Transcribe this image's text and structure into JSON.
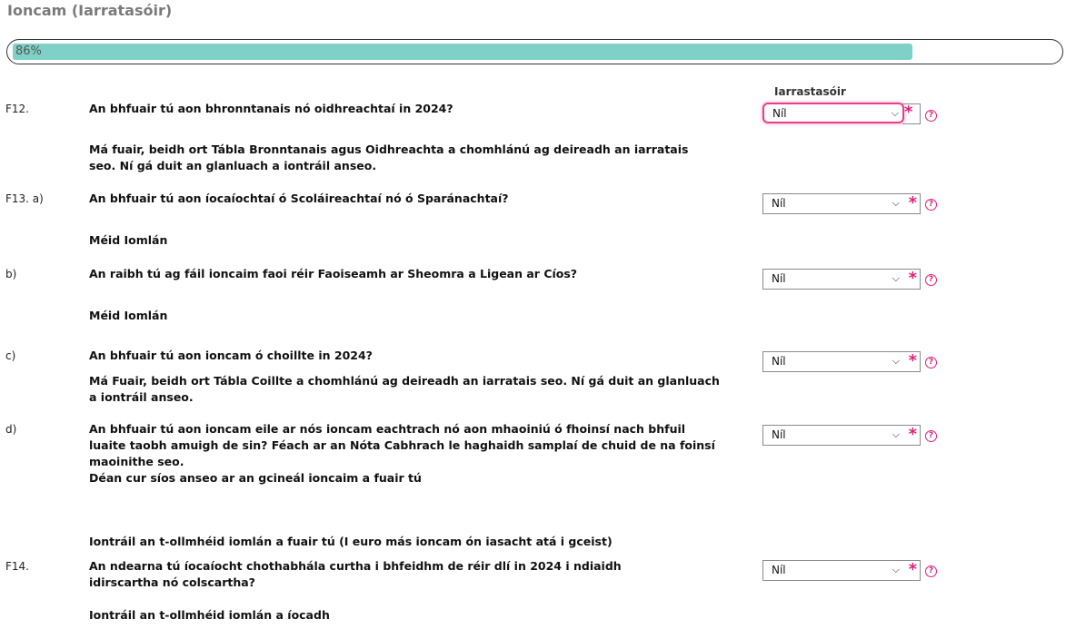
{
  "page": {
    "title": "Ioncam (Iarratasóir)"
  },
  "progress": {
    "percent": 86,
    "label": "86%"
  },
  "column_header": "Iarrastasóir",
  "questions": [
    {
      "num": "F12.",
      "text": "An bhfuair tú aon bhronntanais nó oidhreachtaí in 2024?",
      "value": "Níl"
    },
    {
      "text": "Má fuair, beidh ort Tábla Bronntanais agus Oidhreachta a chomhlánú ag deireadh an iarratais seo. Ní gá duit an glanluach a iontráil anseo."
    },
    {
      "num": "F13. a)",
      "text": "An bhfuair tú aon íocaíochtaí ó Scoláireachtaí nó ó Sparánachtaí?",
      "value": "Níl"
    },
    {
      "text": "Méid Iomlán"
    },
    {
      "num": "b)",
      "text": "An raibh tú ag fáil ioncaim faoi réir Faoiseamh ar Sheomra a Ligean ar Cíos?",
      "value": "Níl"
    },
    {
      "text": "Méid Iomlán"
    },
    {
      "num": "c)",
      "text": "An bhfuair tú aon ioncam ó choillte in 2024?",
      "value": "Níl"
    },
    {
      "text": "Má Fuair, beidh ort Tábla Coillte a chomhlánú ag deireadh an iarratais seo. Ní gá duit an glanluach a iontráil anseo."
    },
    {
      "num": "d)",
      "text": "An bhfuair tú aon ioncam eile ar nós ioncam eachtrach nó aon mhaoiniú ó fhoinsí nach bhfuil luaite taobh amuigh de sin? Féach ar an Nóta Cabhrach le haghaidh samplaí de chuid de na foinsí maoinithe seo.",
      "value": "Níl"
    },
    {
      "text": "Déan cur síos anseo ar an gcineál ioncaim a fuair tú"
    },
    {
      "text": "Iontráil an t-ollmhéid iomlán a fuair tú (I euro más ioncam ón iasacht atá i gceist)"
    },
    {
      "num": "F14.",
      "text": "An ndearna tú íocaíocht chothabhála curtha i bhfeidhm de réir dlí in 2024 i ndiaidh idirscartha nó colscartha?",
      "value": "Níl"
    },
    {
      "text": "Iontráil an t-ollmhéid iomlán a íocadh"
    }
  ],
  "icons": {
    "required": "*",
    "help": "?"
  },
  "colors": {
    "progress": "#7fd1c8",
    "accent": "#e0217a"
  }
}
